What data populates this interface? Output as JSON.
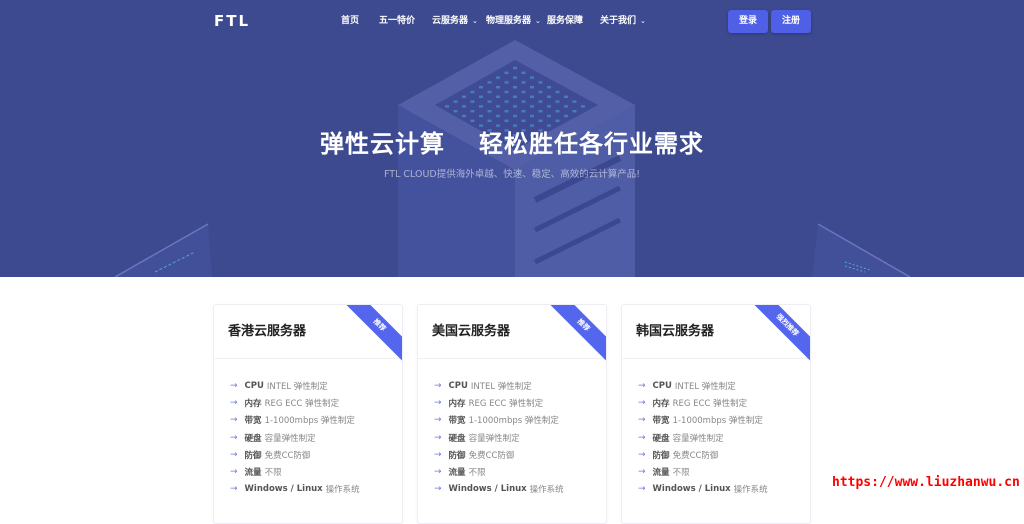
{
  "nav": {
    "logo": "FTL",
    "items": [
      {
        "label": "首页",
        "has_dropdown": false
      },
      {
        "label": "五一特价",
        "has_dropdown": false
      },
      {
        "label": "云服务器",
        "has_dropdown": true
      },
      {
        "label": "物理服务器",
        "has_dropdown": true
      },
      {
        "label": "服务保障",
        "has_dropdown": false
      },
      {
        "label": "关于我们",
        "has_dropdown": true
      }
    ],
    "chevron": "⌄",
    "login_label": "登录",
    "register_label": "注册"
  },
  "hero": {
    "title_left": "弹性云计算",
    "title_right": "轻松胜任各行业需求",
    "subtitle": "FTL CLOUD提供海外卓越、快速、稳定、高效的云计算产品!"
  },
  "colors": {
    "hero_bg": "#3d4a8f",
    "accent": "#5466ee",
    "button": "#4f5fe6"
  },
  "cards": [
    {
      "title": "香港云服务器",
      "badge": "推荐",
      "specs": [
        {
          "key": "CPU",
          "value": "INTEL 弹性制定"
        },
        {
          "key": "内存",
          "value": "REG ECC 弹性制定"
        },
        {
          "key": "带宽",
          "value": "1-1000mbps 弹性制定"
        },
        {
          "key": "硬盘",
          "value": "容量弹性制定"
        },
        {
          "key": "防御",
          "value": "免费CC防御"
        },
        {
          "key": "流量",
          "value": "不限"
        },
        {
          "key": "Windows / Linux",
          "value": "操作系统"
        }
      ]
    },
    {
      "title": "美国云服务器",
      "badge": "推荐",
      "specs": [
        {
          "key": "CPU",
          "value": "INTEL 弹性制定"
        },
        {
          "key": "内存",
          "value": "REG ECC 弹性制定"
        },
        {
          "key": "带宽",
          "value": "1-1000mbps 弹性制定"
        },
        {
          "key": "硬盘",
          "value": "容量弹性制定"
        },
        {
          "key": "防御",
          "value": "免费CC防御"
        },
        {
          "key": "流量",
          "value": "不限"
        },
        {
          "key": "Windows / Linux",
          "value": "操作系统"
        }
      ]
    },
    {
      "title": "韩国云服务器",
      "badge": "强烈推荐",
      "specs": [
        {
          "key": "CPU",
          "value": "INTEL 弹性制定"
        },
        {
          "key": "内存",
          "value": "REG ECC 弹性制定"
        },
        {
          "key": "带宽",
          "value": "1-1000mbps 弹性制定"
        },
        {
          "key": "硬盘",
          "value": "容量弹性制定"
        },
        {
          "key": "防御",
          "value": "免费CC防御"
        },
        {
          "key": "流量",
          "value": "不限"
        },
        {
          "key": "Windows / Linux",
          "value": "操作系统"
        }
      ]
    }
  ],
  "spec_arrow": "→",
  "watermark": "https://www.liuzhanwu.cn"
}
